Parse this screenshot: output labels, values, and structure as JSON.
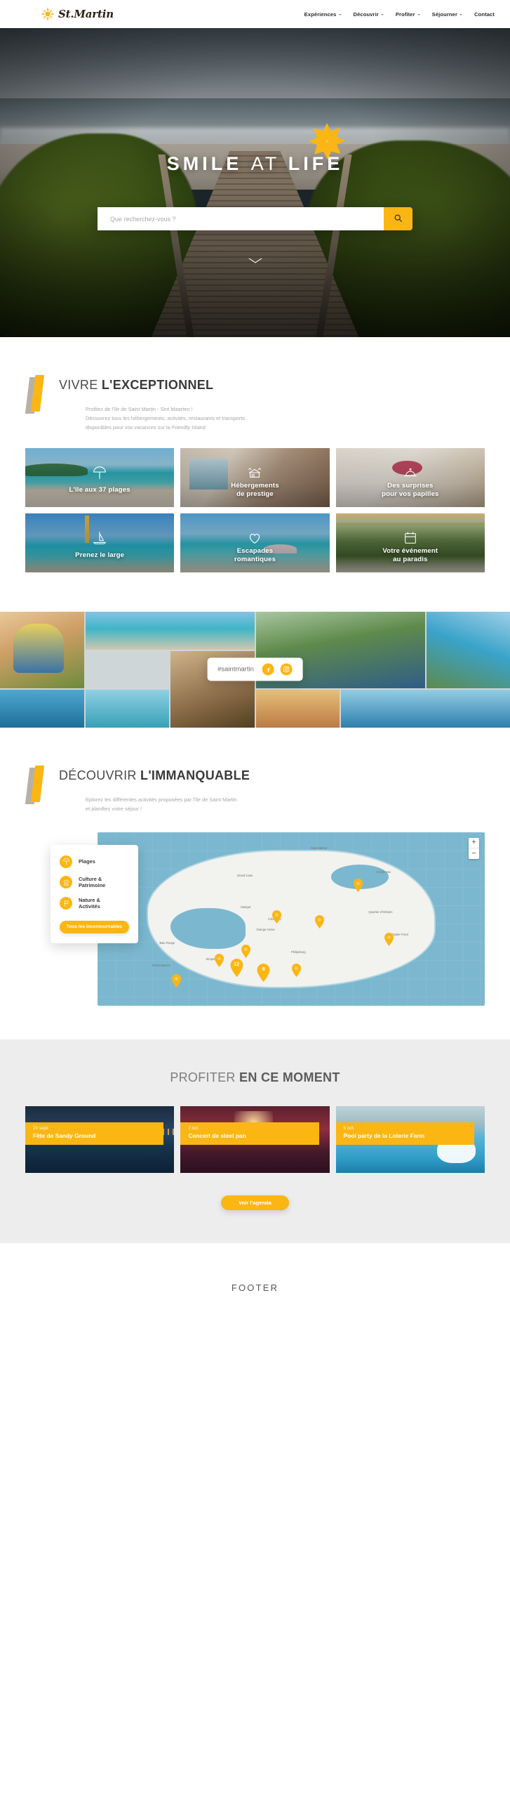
{
  "header": {
    "brand_name": "St.Martin",
    "brand_icon": "sun-star-icon",
    "nav": [
      {
        "label": "Expériences",
        "has_dropdown": true
      },
      {
        "label": "Découvrir",
        "has_dropdown": true
      },
      {
        "label": "Profiter",
        "has_dropdown": true
      },
      {
        "label": "Séjourner",
        "has_dropdown": true
      },
      {
        "label": "Contact",
        "has_dropdown": false
      }
    ]
  },
  "hero": {
    "title_part1": "SMILE",
    "title_part2": "AT",
    "title_part3": "LIFE",
    "splat_icon": "sun-splat-icon",
    "search": {
      "placeholder": "Que recherchez-vous ?",
      "value": "",
      "button_icon": "search-icon"
    },
    "scroll_cue_icon": "chevron-down-icon"
  },
  "experiences": {
    "title_light": "VIVRE",
    "title_bold": "L'EXCEPTIONNEL",
    "subtitle_line1": "Profitez de l'île de Saint Martin - Sint Maarten !",
    "subtitle_line2": "Découvrez tous les hébergements, activités, restaurants et transports",
    "subtitle_line3": "disponibles pour vos vacances sur la Friendly Island",
    "cards": [
      {
        "label": "L'île aux 37 plages",
        "icon": "beach-umbrella-icon",
        "photo": "beach"
      },
      {
        "label": "Hébergements\nde prestige",
        "icon": "villa-icon",
        "photo": "villa"
      },
      {
        "label": "Des surprises\npour vos papilles",
        "icon": "cloche-dining-icon",
        "photo": "dining"
      },
      {
        "label": "Prenez le large",
        "icon": "sailboat-icon",
        "photo": "sail"
      },
      {
        "label": "Escapades\nromantiques",
        "icon": "heart-icon",
        "photo": "romance"
      },
      {
        "label": "Votre événement\nau paradis",
        "icon": "calendar-icon",
        "photo": "resort"
      }
    ]
  },
  "instagram": {
    "hashtag": "#saintmartin",
    "facebook_icon": "facebook-icon",
    "instagram_icon": "instagram-icon"
  },
  "discover": {
    "title_light": "DÉCOUVRIR",
    "title_bold": "L'IMMANQUABLE",
    "subtitle_line1": "Eplorez les différentes activités proposées par l'île de Saint Martin",
    "subtitle_line2": "et planifiez votre séjour !",
    "legend": [
      {
        "label": "Plages",
        "icon": "beach-umbrella-icon"
      },
      {
        "label": "Culture &\nPatrimoine",
        "icon": "monument-icon"
      },
      {
        "label": "Nature &\nActivités",
        "icon": "flag-icon"
      }
    ],
    "legend_button": "Tous les incontournables",
    "map": {
      "zoom_in": "+",
      "zoom_out": "−",
      "place_labels": [
        "Anse Marcel",
        "Cul-de-Sac",
        "Grand Case",
        "Marigot",
        "Colombier",
        "Quartier d'Orléans",
        "Orange Grove",
        "Philipsburg",
        "Simpson Bay",
        "Oyster Pond",
        "Baie Rouge",
        "Terres Basses"
      ],
      "markers": [
        {
          "type": "pin"
        },
        {
          "type": "pin"
        },
        {
          "type": "pin"
        },
        {
          "type": "pin"
        },
        {
          "type": "pin"
        },
        {
          "type": "pin"
        },
        {
          "type": "pin"
        },
        {
          "type": "pin"
        },
        {
          "type": "cluster",
          "count": "12"
        },
        {
          "type": "cluster",
          "count": "8"
        }
      ]
    }
  },
  "agenda": {
    "title_light": "PROFITER",
    "title_bold": "EN CE MOMENT",
    "events": [
      {
        "date": "29 sept.",
        "name": "Fête de Sandy Ground",
        "photo": "night"
      },
      {
        "date": "2 oct.",
        "name": "Concert de steel pan",
        "photo": "concert"
      },
      {
        "date": "6 oct.",
        "name": "Pool party de la Loterie Farm",
        "photo": "pool"
      }
    ],
    "cta": "Voir l'agenda"
  },
  "footer": {
    "text": "FOOTER"
  },
  "colors": {
    "accent_yellow": "#FBB614",
    "map_water": "#7BB8CF",
    "agenda_bg": "#EDEDED",
    "heading_grey": "#4A4A4A"
  }
}
